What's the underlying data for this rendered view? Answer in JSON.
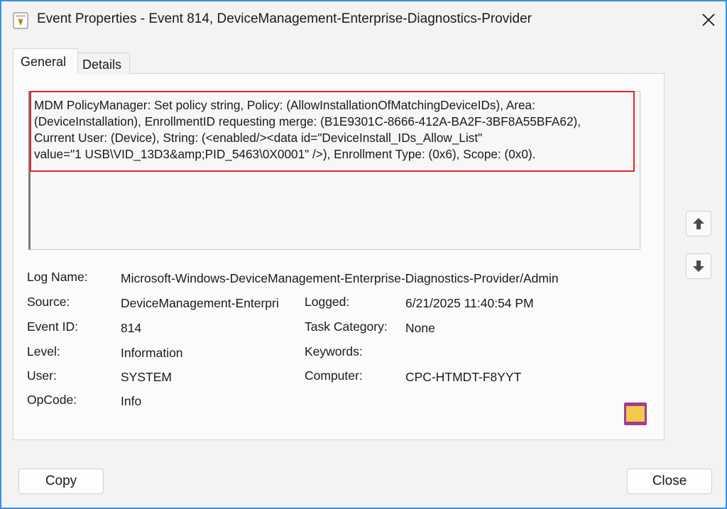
{
  "window": {
    "title": "Event Properties - Event 814, DeviceManagement-Enterprise-Diagnostics-Provider"
  },
  "tabs": [
    {
      "label": "General",
      "selected": true
    },
    {
      "label": "Details",
      "selected": false
    }
  ],
  "description": "MDM PolicyManager: Set policy string, Policy: (AllowInstallationOfMatchingDeviceIDs), Area:\n(DeviceInstallation), EnrollmentID requesting merge: (B1E9301C-8666-412A-BA2F-3BF8A55BFA62),\nCurrent User: (Device), String: (<enabled/><data id=\"DeviceInstall_IDs_Allow_List\"\nvalue=\"1  USB\\VID_13D3&amp;PID_5463\\0X0001\" />), Enrollment Type: (0x6), Scope: (0x0).",
  "fields": {
    "log_name": {
      "label": "Log Name:",
      "value": "Microsoft-Windows-DeviceManagement-Enterprise-Diagnostics-Provider/Admin"
    },
    "source": {
      "label": "Source:",
      "value": "DeviceManagement-Enterpri"
    },
    "logged": {
      "label": "Logged:",
      "value": "6/21/2025 11:40:54 PM"
    },
    "event_id": {
      "label": "Event ID:",
      "value": "814"
    },
    "task_category": {
      "label": "Task Category:",
      "value": "None"
    },
    "level": {
      "label": "Level:",
      "value": "Information"
    },
    "keywords": {
      "label": "Keywords:",
      "value": ""
    },
    "user": {
      "label": "User:",
      "value": "SYSTEM"
    },
    "computer": {
      "label": "Computer:",
      "value": "CPC-HTMDT-F8YYT"
    },
    "opcode": {
      "label": "OpCode:",
      "value": "Info"
    }
  },
  "buttons": {
    "copy": "Copy",
    "close": "Close"
  },
  "icons": {
    "app": "event-viewer-icon",
    "close": "close-icon",
    "up": "arrow-up-icon",
    "down": "arrow-down-icon",
    "watermark": "logo-icon"
  },
  "colors": {
    "window_border": "#3a8ee6",
    "highlight": "#e0262a"
  }
}
